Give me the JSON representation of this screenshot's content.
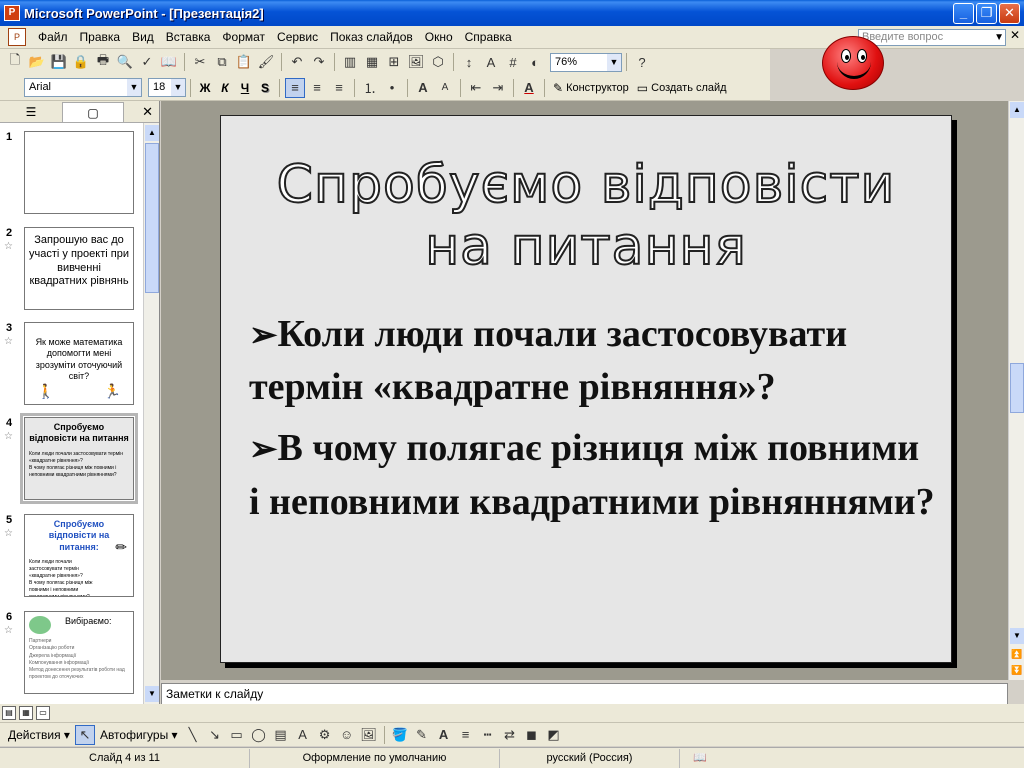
{
  "window": {
    "title": "Microsoft PowerPoint - [Презентація2]"
  },
  "menu": {
    "items": [
      "Файл",
      "Правка",
      "Вид",
      "Вставка",
      "Формат",
      "Сервис",
      "Показ слайдов",
      "Окно",
      "Справка"
    ],
    "help_placeholder": "Введите вопрос"
  },
  "toolbar": {
    "zoom": "76%"
  },
  "format": {
    "font": "Arial",
    "size": "18",
    "bold": "Ж",
    "italic": "К",
    "underline": "Ч",
    "shadow": "S",
    "design_label": "Конструктор",
    "new_slide_label": "Создать слайд"
  },
  "slides_pane": {
    "slides": [
      {
        "num": "1",
        "text": ""
      },
      {
        "num": "2",
        "text": "Запрошую вас до участі у проекті при вивченні квадратних рівнянь"
      },
      {
        "num": "3",
        "text": "Як може математика допомогти мені зрозуміти оточуючий світ?"
      },
      {
        "num": "4",
        "text": "Спробуємо відповісти на питання"
      },
      {
        "num": "5",
        "text": "Спробуємо відповісти на питання:"
      },
      {
        "num": "6",
        "text": "Вибіраємо:"
      }
    ],
    "slide6_items": [
      "Партнери",
      "Організацію роботи",
      "Джерела інформації",
      "Компонування інформації",
      "Метод донесення результатів роботи над проектом до оточуючих"
    ]
  },
  "slide": {
    "title": "Спробуємо відповісти на питання",
    "bullets": [
      "Коли люди почали застосовувати термін «квадратне рівняння»?",
      "В чому полягає різниця між повними і неповними квадратними рівняннями?"
    ]
  },
  "notes": {
    "placeholder": "Заметки к слайду"
  },
  "drawing": {
    "actions_label": "Действия",
    "autoshapes_label": "Автофигуры"
  },
  "status": {
    "slide_position": "Слайд 4 из 11",
    "design": "Оформление по умолчанию",
    "language": "русский (Россия)"
  }
}
